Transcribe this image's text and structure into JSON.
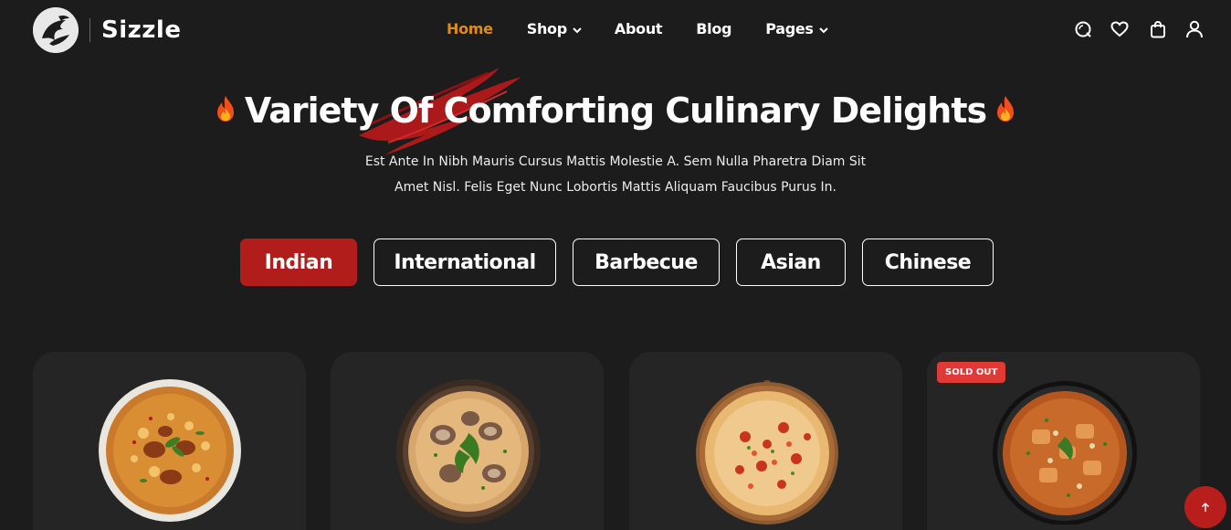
{
  "brand": {
    "name": "Sizzle",
    "logo_icon": "dragon-logo-icon"
  },
  "nav": {
    "items": [
      {
        "label": "Home",
        "active": true,
        "dropdown": false
      },
      {
        "label": "Shop",
        "active": false,
        "dropdown": true
      },
      {
        "label": "About",
        "active": false,
        "dropdown": false
      },
      {
        "label": "Blog",
        "active": false,
        "dropdown": false
      },
      {
        "label": "Pages",
        "active": false,
        "dropdown": true
      }
    ]
  },
  "header_icons": [
    "search-icon",
    "heart-icon",
    "shopping-bag-icon",
    "user-icon"
  ],
  "hero": {
    "title": "Variety Of Comforting Culinary Delights",
    "subtitle_line1": "Est Ante In Nibh Mauris Cursus Mattis Molestie A. Sem Nulla Pharetra Diam Sit",
    "subtitle_line2": "Amet Nisl. Felis Eget Nunc Lobortis Mattis Aliquam Faucibus Purus In."
  },
  "tabs": [
    {
      "label": "Indian",
      "active": true
    },
    {
      "label": "International",
      "active": false
    },
    {
      "label": "Barbecue",
      "active": false
    },
    {
      "label": "Asian",
      "active": false
    },
    {
      "label": "Chinese",
      "active": false
    }
  ],
  "cards": [
    {
      "image": "biryani-bowl",
      "badge": ""
    },
    {
      "image": "mushroom-soup-bowl",
      "badge": ""
    },
    {
      "image": "pizza-on-board",
      "badge": ""
    },
    {
      "image": "curry-bowl",
      "badge": "SOLD OUT"
    }
  ],
  "scroll_top": {
    "icon": "arrow-up-icon"
  },
  "colors": {
    "accent": "#b11d1b",
    "nav_active": "#e08a1a",
    "background": "#1c1c1c",
    "card": "#252525",
    "badge": "#e03a37"
  }
}
